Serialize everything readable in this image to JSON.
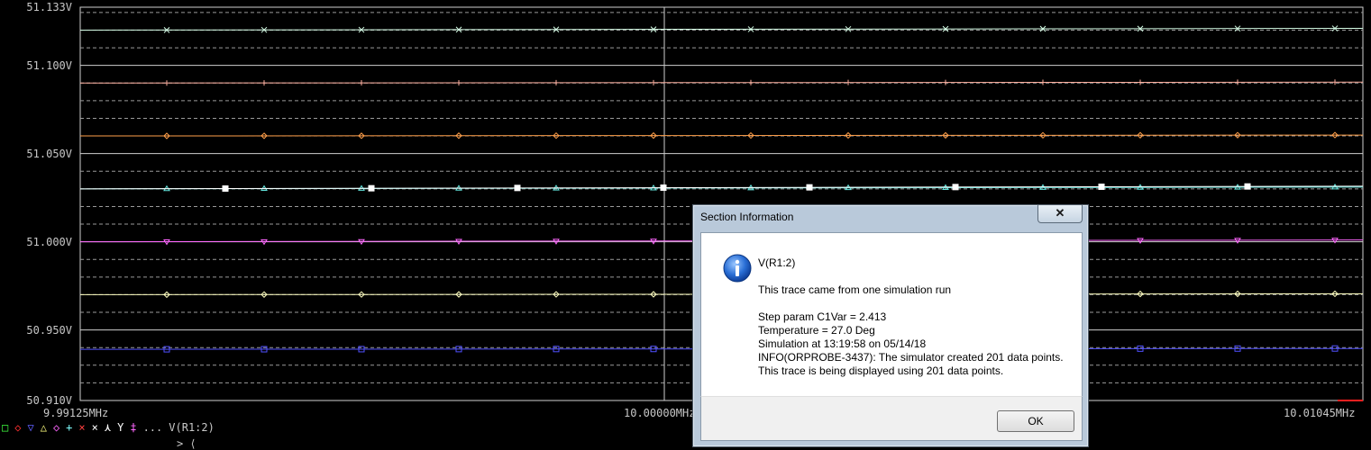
{
  "chart_data": {
    "type": "line",
    "title": "",
    "xlabel": "",
    "ylabel": "",
    "xlim": [
      9.99125,
      10.01045
    ],
    "ylim": [
      50.91,
      51.133
    ],
    "x_tick_labels": [
      "9.99125MHz",
      "10.00000MHz",
      "10.01045MHz"
    ],
    "y_tick_labels": [
      "51.133V",
      "51.100V",
      "51.050V",
      "51.000V",
      "50.950V",
      "50.910V"
    ],
    "y_tick_values": [
      51.133,
      51.1,
      51.05,
      51.0,
      50.95,
      50.91
    ],
    "series": [
      {
        "color": "#d7ffe8",
        "marker": "x",
        "start": 51.12,
        "end": 51.121
      },
      {
        "color": "#ffb0a0",
        "marker": "+",
        "start": 51.09,
        "end": 51.0905
      },
      {
        "color": "#ff9f4a",
        "marker": "diamond",
        "start": 51.06,
        "end": 51.0605
      },
      {
        "color": "#64e8e0",
        "marker": "triangle",
        "start": 51.03,
        "end": 51.031
      },
      {
        "color": "#ffffff",
        "marker": "square",
        "start": 51.03,
        "end": 51.0315
      },
      {
        "color": "#ff66ff",
        "marker": "nabla",
        "start": 51.0,
        "end": 51.001
      },
      {
        "color": "#ffffc0",
        "marker": "diamond",
        "start": 50.97,
        "end": 50.9705
      },
      {
        "color": "#5050ff",
        "marker": "square",
        "start": 50.939,
        "end": 50.9395
      }
    ]
  },
  "legend": {
    "symbols": [
      {
        "glyph": "□",
        "color": "#40ff40"
      },
      {
        "glyph": "◇",
        "color": "#ff3030"
      },
      {
        "glyph": "▽",
        "color": "#6060ff"
      },
      {
        "glyph": "△",
        "color": "#ffff80"
      },
      {
        "glyph": "◇",
        "color": "#ff66ff"
      },
      {
        "glyph": "+",
        "color": "#80ffff"
      },
      {
        "glyph": "×",
        "color": "#ff4040"
      },
      {
        "glyph": "×",
        "color": "#ffffff"
      },
      {
        "glyph": "⋏",
        "color": "#ffffff"
      },
      {
        "glyph": "Y",
        "color": "#ffffff"
      },
      {
        "glyph": "‡",
        "color": "#ff66ff"
      }
    ],
    "ellipsis": "...",
    "trace_label": "V(R1:2)",
    "tail": "> ⟨"
  },
  "dialog": {
    "title": "Section Information",
    "close_label": "✕",
    "lines": [
      "V(R1:2)",
      "This trace came from one simulation run",
      "Step param C1Var =     2.413",
      "Temperature =  27.0 Deg",
      "Simulation at 13:19:58 on 05/14/18",
      "INFO(ORPROBE-3437): The simulator created 201 data points.",
      "This trace is being displayed using 201 data points."
    ],
    "ok_label": "OK"
  }
}
